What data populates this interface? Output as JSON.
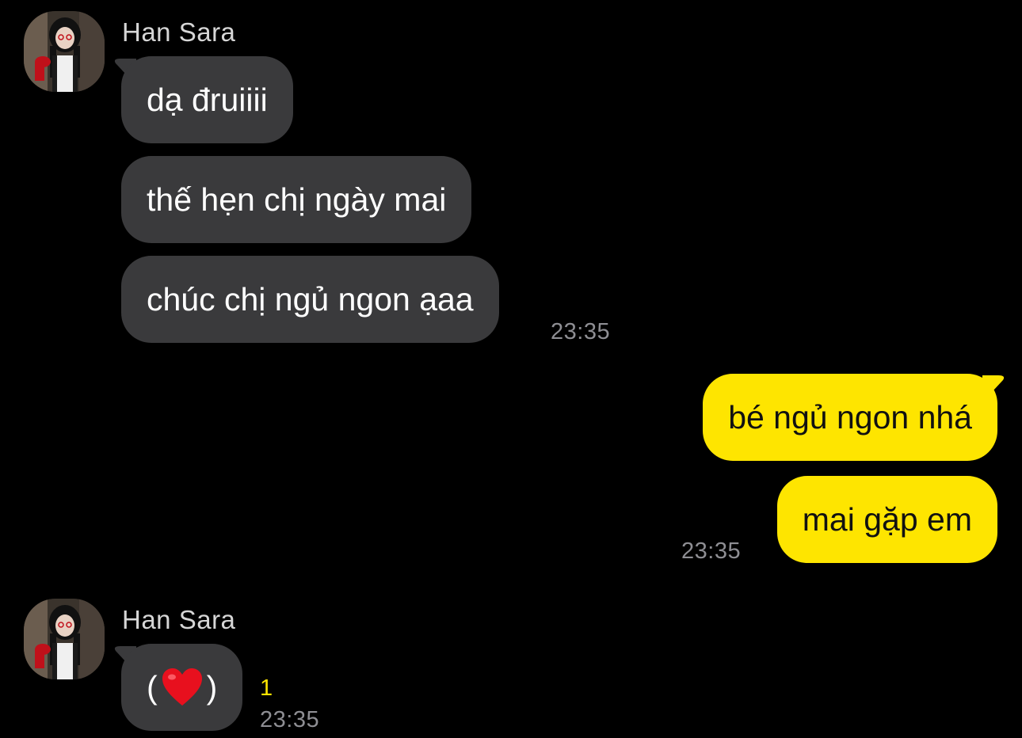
{
  "groups": [
    {
      "sender": "Han Sara",
      "messages": [
        "dạ đruiiii",
        "thế hẹn chị ngày mai",
        "chúc chị ngủ ngon ạaa"
      ],
      "time": "23:35"
    },
    {
      "messages": [
        "bé ngủ ngon nhá",
        "mai gặp em"
      ],
      "time": "23:35"
    },
    {
      "sender": "Han Sara",
      "reaction": {
        "open": "(",
        "emoji": "heart-emoji",
        "close": ")"
      },
      "unread_count": "1",
      "time": "23:35"
    }
  ],
  "colors": {
    "background": "#000000",
    "incoming_bubble": "#3a3a3c",
    "outgoing_bubble": "#fee500",
    "unread": "#fee500",
    "timestamp": "#8e8e93"
  }
}
